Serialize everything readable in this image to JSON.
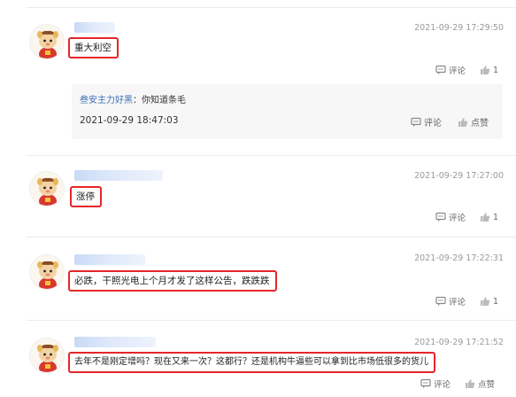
{
  "comments": [
    {
      "time": "2021-09-29 17:29:50",
      "content": "重大利空",
      "comment_label": "评论",
      "like_count": "1",
      "reply": {
        "author": "叁安主力好黑",
        "separator": "：",
        "text": "你知道条毛",
        "time": "2021-09-29 18:47:03",
        "comment_label": "评论",
        "like_label": "点赞"
      }
    },
    {
      "time": "2021-09-29 17:27:00",
      "content": "涨停",
      "comment_label": "评论",
      "like_count": "1"
    },
    {
      "time": "2021-09-29 17:22:31",
      "content": "必跌，干照光电上个月才发了这样公告，跌跌跌",
      "comment_label": "评论",
      "like_count": "1"
    },
    {
      "time": "2021-09-29 17:21:52",
      "content": "去年不是刚定增吗？现在又来一次？这都行？还是机构牛逼些可以拿到比市场低很多的货儿",
      "comment_label": "评论",
      "like_label": "点赞"
    }
  ],
  "colors": {
    "highlight": "#e5262b",
    "link": "#3a6fb5"
  },
  "icons": {
    "comment": "comment-bubble-icon",
    "like": "thumbs-up-icon",
    "avatar": "mascot-avatar"
  }
}
